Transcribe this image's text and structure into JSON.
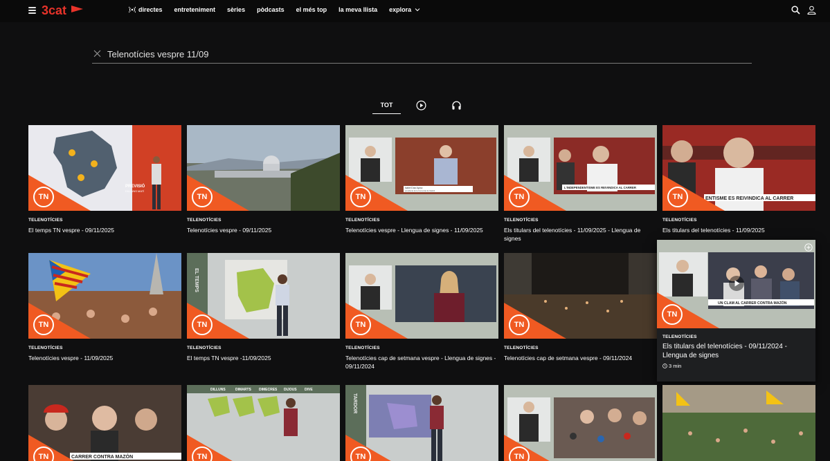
{
  "header": {
    "logo_text": "3cat",
    "nav": [
      {
        "label": "directes",
        "icon": "live-broadcast-icon"
      },
      {
        "label": "entreteniment"
      },
      {
        "label": "sèries"
      },
      {
        "label": "pòdcasts"
      },
      {
        "label": "el més top"
      },
      {
        "label": "la meva llista"
      },
      {
        "label": "explora",
        "icon": "chevron-down-icon"
      }
    ]
  },
  "search": {
    "value": "Telenotícies vespre 11/09"
  },
  "tabs": {
    "all": "TOT",
    "video_icon": "play-circle-icon",
    "audio_icon": "headphones-icon"
  },
  "colors": {
    "accent": "#f05a22",
    "background": "#0f0f10"
  },
  "cards": [
    {
      "category": "TELENOTÍCIES",
      "title": "El temps TN vespre - 09/11/2025"
    },
    {
      "category": "TELENOTÍCIES",
      "title": "Telenotícies vespre - 09/11/2025"
    },
    {
      "category": "TELENOTÍCIES",
      "title": "Telenotícies vespre - Llengua de signes - 11/09/2025"
    },
    {
      "category": "TELENOTÍCIES",
      "title": "Els titulars del telenotícies - 11/09/2025 - Llengua de signes"
    },
    {
      "category": "TELENOTÍCIES",
      "title": "Els titulars del telenotícies - 11/09/2025"
    },
    {
      "category": "TELENOTÍCIES",
      "title": "Telenotícies vespre - 11/09/2025"
    },
    {
      "category": "TELENOTÍCIES",
      "title": "El temps TN vespre -11/09/2025"
    },
    {
      "category": "TELENOTÍCIES",
      "title": "Telenotícies cap de setmana vespre - Llengua de signes - 09/11/2024"
    },
    {
      "category": "TELENOTÍCIES",
      "title": "Telenotícies cap de setmana vespre - 09/11/2024"
    }
  ],
  "hover_card": {
    "category": "TELENOTÍCIES",
    "title": "Els titulars del telenotícies - 09/11/2024 - Llengua de signes",
    "duration": "3 min"
  },
  "thumb_captions": {
    "forecast": "PREVISIÓ",
    "forecast_sub": "DILLUNS MATÍ",
    "sign_lower_third": "Isabel Díaz Ayuso",
    "sign_lower_third_sub": "presidenta de la Comunitat de Madrid",
    "protest_banner": "L'INDEPENDENTISME ES REIVINDICA AL CARRER",
    "protest_banner_crop": "ENTISME ES REIVINDICA AL CARRER",
    "mazon_banner": "UN CLAM AL CARRER CONTRA MAZÓN",
    "mazon_banner_row3": "CARRER CONTRA MAZÓN",
    "tn_tag": "TN",
    "weather_days": [
      "DILLUNS",
      "DIMARTS",
      "DIMECRES",
      "DIJOUS",
      "DIVE"
    ],
    "tardor": "TARDOR",
    "temps": "EL TEMPS"
  }
}
